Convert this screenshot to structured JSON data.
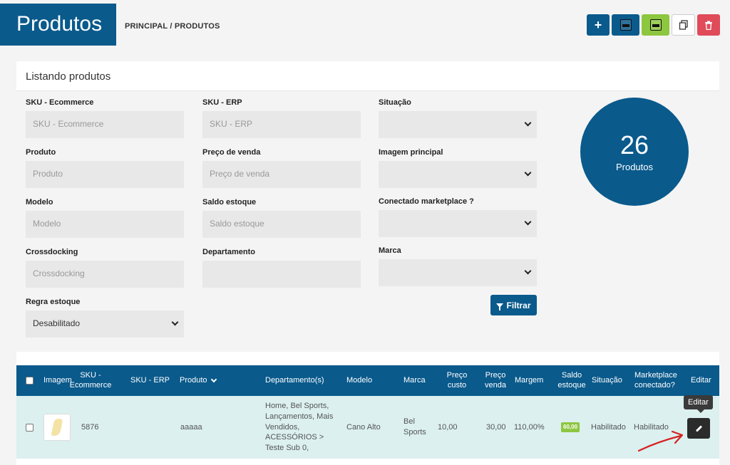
{
  "header": {
    "title": "Produtos",
    "breadcrumb": "PRINCIPAL / PRODUTOS",
    "actions": [
      {
        "name": "add-button",
        "icon": "plus-icon",
        "label": "+"
      },
      {
        "name": "export-csv-button",
        "icon": "csv-file-icon"
      },
      {
        "name": "export-xls-button",
        "icon": "xls-file-icon"
      },
      {
        "name": "copy-button",
        "icon": "copy-icon"
      },
      {
        "name": "delete-button",
        "icon": "trash-icon"
      }
    ]
  },
  "panel": {
    "title": "Listando produtos",
    "fields": {
      "sku_ecommerce": {
        "label": "SKU - Ecommerce",
        "placeholder": "SKU - Ecommerce"
      },
      "sku_erp": {
        "label": "SKU - ERP",
        "placeholder": "SKU - ERP"
      },
      "situacao": {
        "label": "Situação",
        "value": ""
      },
      "produto": {
        "label": "Produto",
        "placeholder": "Produto"
      },
      "preco_venda": {
        "label": "Preço de venda",
        "placeholder": "Preço de venda"
      },
      "imagem_principal": {
        "label": "Imagem principal",
        "value": ""
      },
      "modelo": {
        "label": "Modelo",
        "placeholder": "Modelo"
      },
      "saldo_estoque": {
        "label": "Saldo estoque",
        "placeholder": "Saldo estoque"
      },
      "conectado_marketplace": {
        "label": "Conectado marketplace ?",
        "value": ""
      },
      "crossdocking": {
        "label": "Crossdocking",
        "placeholder": "Crossdocking"
      },
      "departamento": {
        "label": "Departamento",
        "value": ""
      },
      "marca": {
        "label": "Marca",
        "value": ""
      },
      "regra_estoque": {
        "label": "Regra estoque",
        "value": "Desabilitado"
      }
    },
    "filter_label": "Filtrar",
    "counter": {
      "number": "26",
      "label": "Produtos"
    }
  },
  "table": {
    "headers": {
      "imagem": "Imagem",
      "sku_ecommerce_1": "SKU -",
      "sku_ecommerce_2": "Ecommerce",
      "sku_erp": "SKU - ERP",
      "produto": "Produto",
      "departamento": "Departamento(s)",
      "modelo": "Modelo",
      "marca": "Marca",
      "preco_custo_1": "Preço",
      "preco_custo_2": "custo",
      "preco_venda_1": "Preço",
      "preco_venda_2": "venda",
      "margem": "Margem",
      "saldo_estoque_1": "Saldo",
      "saldo_estoque_2": "estoque",
      "situacao": "Situação",
      "marketplace_1": "Marketplace",
      "marketplace_2": "conectado?",
      "editar": "Editar"
    },
    "rows": [
      {
        "sku_ecommerce": "5876",
        "sku_erp": "",
        "produto": "aaaaa",
        "departamento": "Home, Bel Sports, Lançamentos, Mais Vendidos, ACESSÓRIOS > Teste Sub 0,",
        "modelo": "Cano Alto",
        "marca": "Bel Sports",
        "preco_custo": "10,00",
        "preco_venda": "30,00",
        "margem": "110,00%",
        "saldo_estoque": "60,00",
        "situacao": "Habilitado",
        "marketplace": "Habilitado"
      }
    ],
    "edit_tooltip": "Editar"
  },
  "colors": {
    "primary": "#0a5a8c",
    "success": "#8dc63f",
    "danger": "#e04b5a",
    "row_highlight": "#dbf0ef",
    "annotation": "#d62020"
  }
}
